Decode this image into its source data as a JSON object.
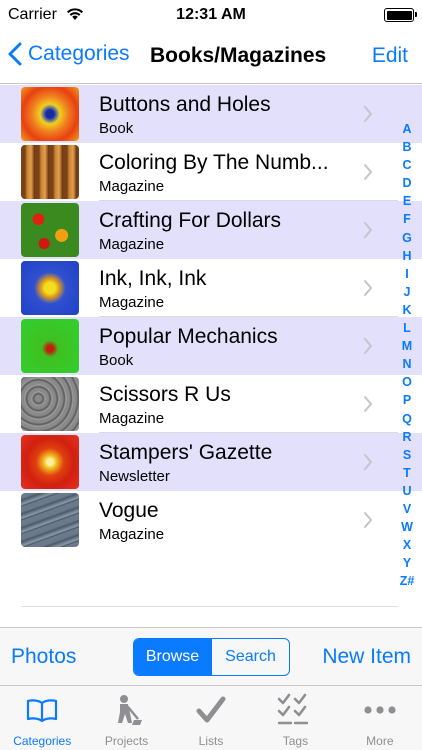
{
  "status_bar": {
    "carrier": "Carrier",
    "time": "12:31 AM"
  },
  "nav": {
    "back_label": "Categories",
    "title": "Books/Magazines",
    "edit_label": "Edit"
  },
  "items": [
    {
      "title": "Buttons and Holes",
      "subtitle": "Book",
      "thumbnail": "fractal-orange-blue"
    },
    {
      "title": "Coloring By The Numb...",
      "subtitle": "Magazine",
      "thumbnail": "wood-barrels"
    },
    {
      "title": "Crafting For Dollars",
      "subtitle": "Magazine",
      "thumbnail": "red-flowers"
    },
    {
      "title": "Ink, Ink, Ink",
      "subtitle": "Magazine",
      "thumbnail": "fractal-yellow-blue"
    },
    {
      "title": "Popular Mechanics",
      "subtitle": "Book",
      "thumbnail": "fractal-green-red"
    },
    {
      "title": "Scissors R Us",
      "subtitle": "Magazine",
      "thumbnail": "gray-stone"
    },
    {
      "title": "Stampers' Gazette",
      "subtitle": "Newsletter",
      "thumbnail": "fractal-red-yellow"
    },
    {
      "title": "Vogue",
      "subtitle": "Magazine",
      "thumbnail": "slate-roof"
    }
  ],
  "index_letters": [
    "A",
    "B",
    "C",
    "D",
    "E",
    "F",
    "G",
    "H",
    "I",
    "J",
    "K",
    "L",
    "M",
    "N",
    "O",
    "P",
    "Q",
    "R",
    "S",
    "T",
    "U",
    "V",
    "W",
    "X",
    "Y",
    "Z#"
  ],
  "toolbar": {
    "photos_label": "Photos",
    "browse_label": "Browse",
    "search_label": "Search",
    "new_item_label": "New Item",
    "selected_segment": "Browse"
  },
  "tabs": [
    {
      "label": "Categories",
      "icon": "book-icon",
      "active": true
    },
    {
      "label": "Projects",
      "icon": "worker-icon",
      "active": false
    },
    {
      "label": "Lists",
      "icon": "checkmark-icon",
      "active": false
    },
    {
      "label": "Tags",
      "icon": "checklist-icon",
      "active": false
    },
    {
      "label": "More",
      "icon": "more-icon",
      "active": false
    }
  ],
  "colors": {
    "accent": "#0a7aff",
    "row_highlight": "#e3e0fb",
    "inactive_tab": "#8e8e93"
  }
}
